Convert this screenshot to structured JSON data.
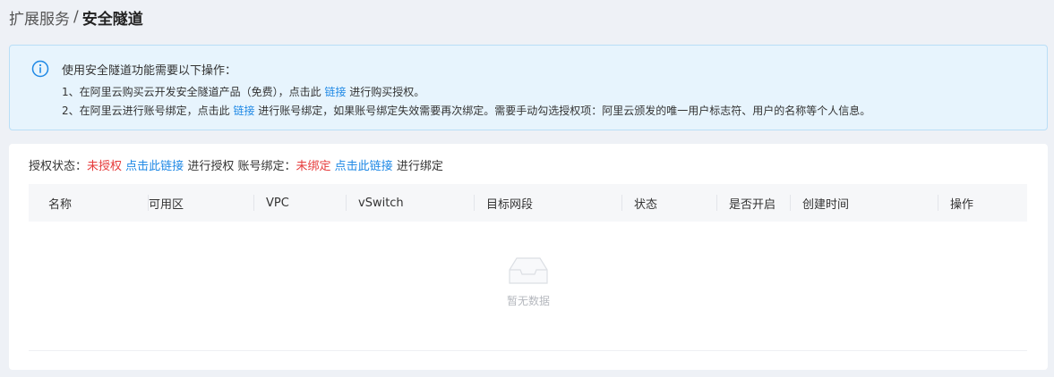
{
  "breadcrumb": {
    "parent": "扩展服务",
    "separator": "/",
    "current": "安全隧道"
  },
  "notice": {
    "title": "使用安全隧道功能需要以下操作：",
    "line1_pre": "1、在阿里云购买云开发安全隧道产品（免费），点击此 ",
    "line1_link": "链接",
    "line1_post": " 进行购买授权。",
    "line2_pre": "2、在阿里云进行账号绑定，点击此 ",
    "line2_link": "链接",
    "line2_post": " 进行账号绑定，如果账号绑定失效需要再次绑定。需要手动勾选授权项：阿里云颁发的唯一用户标志符、用户的名称等个人信息。",
    "info_icon": "info-icon"
  },
  "status": {
    "auth_label": "授权状态：",
    "auth_value": "未授权",
    "auth_link": "点击此链接",
    "auth_post": "进行授权",
    "bind_label": "账号绑定：",
    "bind_value": "未绑定",
    "bind_link": "点击此链接",
    "bind_post": "进行绑定"
  },
  "table": {
    "columns": [
      "名称",
      "可用区",
      "VPC",
      "vSwitch",
      "目标网段",
      "状态",
      "是否开启",
      "创建时间",
      "操作"
    ],
    "rows": [],
    "empty_text": "暂无数据",
    "empty_icon": "empty-inbox-icon"
  },
  "colors": {
    "link": "#1e88e5",
    "danger": "#e63b3b",
    "notice_bg": "#e7f4fd",
    "notice_border": "#b9def6"
  }
}
